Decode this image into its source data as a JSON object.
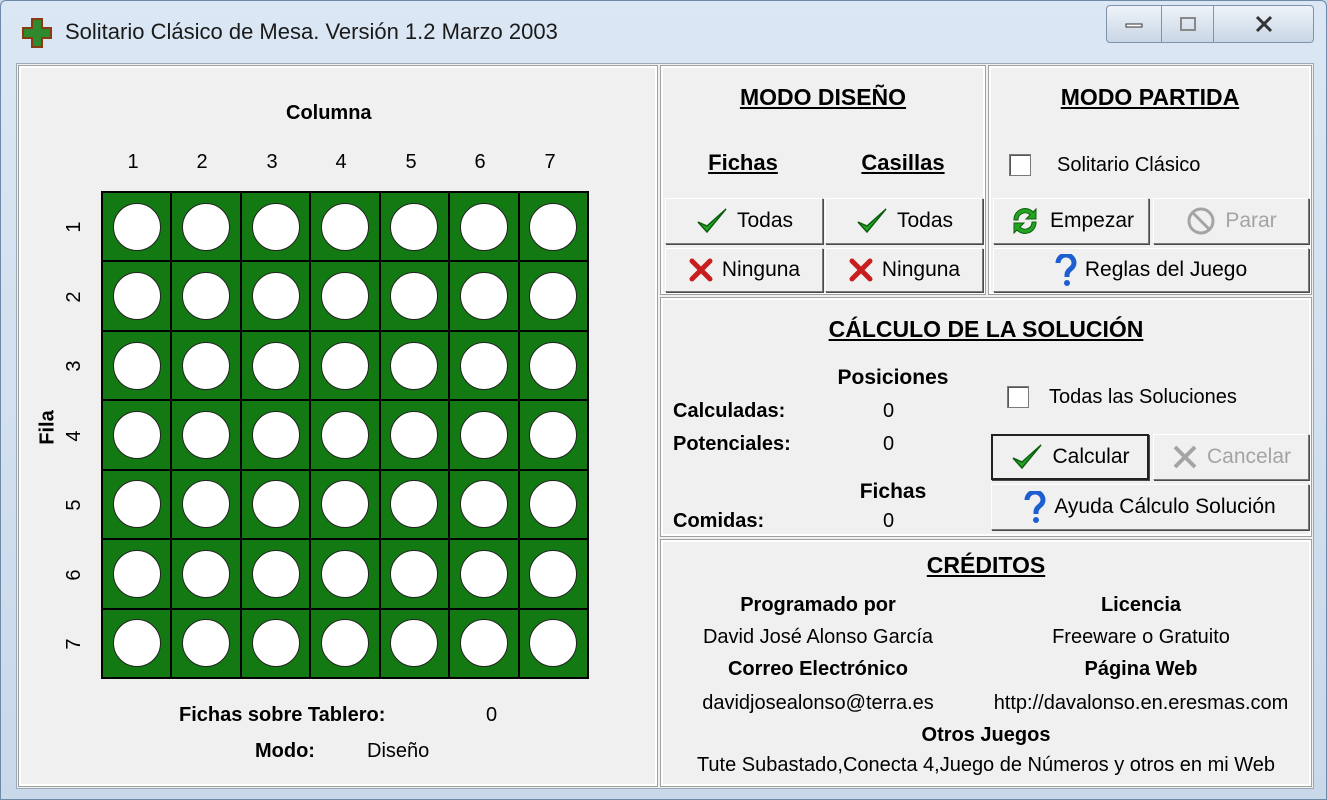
{
  "window": {
    "title": "Solitario Clásico de Mesa. Versión 1.2 Marzo 2003"
  },
  "board": {
    "column_label": "Columna",
    "row_label": "Fila",
    "columns": [
      "1",
      "2",
      "3",
      "4",
      "5",
      "6",
      "7"
    ],
    "rows": [
      "1",
      "2",
      "3",
      "4",
      "5",
      "6",
      "7"
    ],
    "fichas_label": "Fichas sobre Tablero:",
    "fichas_value": "0",
    "modo_label": "Modo:",
    "modo_value": "Diseño"
  },
  "design": {
    "heading": "MODO DISEÑO",
    "fichas_heading": "Fichas",
    "casillas_heading": "Casillas",
    "todas_label": "Todas",
    "ninguna_label": "Ninguna"
  },
  "game": {
    "heading": "MODO PARTIDA",
    "checkbox_label": "Solitario Clásico",
    "start_label": "Empezar",
    "stop_label": "Parar",
    "rules_label": "Reglas del Juego"
  },
  "solution": {
    "heading": "CÁLCULO DE LA SOLUCIÓN",
    "positions_heading": "Posiciones",
    "calculated_label": "Calculadas:",
    "calculated_value": "0",
    "potential_label": "Potenciales:",
    "potential_value": "0",
    "fichas_heading": "Fichas",
    "eaten_label": "Comidas:",
    "eaten_value": "0",
    "all_solutions_label": "Todas las Soluciones",
    "calc_label": "Calcular",
    "cancel_label": "Cancelar",
    "help_label": "Ayuda Cálculo Solución"
  },
  "credits": {
    "heading": "CRÉDITOS",
    "programmed_heading": "Programado por",
    "programmer": "David José Alonso García",
    "license_heading": "Licencia",
    "license": "Freeware o Gratuito",
    "email_heading": "Correo Electrónico",
    "email": "davidjosealonso@terra.es",
    "web_heading": "Página Web",
    "web": "http://davalonso.en.eresmas.com",
    "other_heading": "Otros Juegos",
    "other": "Tute Subastado,Conecta 4,Juego de Números y otros en mi Web"
  },
  "colors": {
    "board_green": "#137a13",
    "check_green": "#22a322",
    "cross_red": "#c81e1e",
    "help_blue": "#1d5fd1"
  }
}
